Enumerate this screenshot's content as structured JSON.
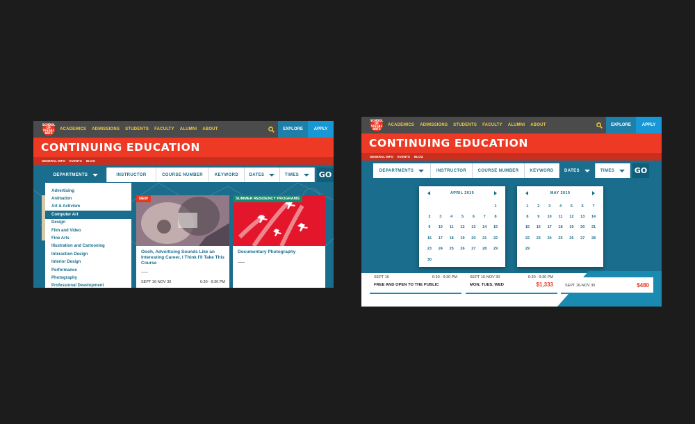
{
  "logo_text": "SCHOOL OF VISUAL ARTS",
  "nav": {
    "items": [
      "ACADEMICS",
      "ADMISSIONS",
      "STUDENTS",
      "FACULTY",
      "ALUMNI",
      "ABOUT"
    ],
    "explore": "EXPLORE",
    "apply": "APPLY"
  },
  "page_title": "CONTINUING EDUCATION",
  "subnav": [
    "GENERAL INFO",
    "EVENTS",
    "BLOG"
  ],
  "filters": {
    "departments": "DEPARTMENTS",
    "instructor": "INSTRUCTOR",
    "course_number": "COURSE NUMBER",
    "keyword": "KEYWORD",
    "dates": "DATES",
    "times": "TIMES",
    "go": "GO"
  },
  "departments_menu": {
    "selected": "Computer Art",
    "items": [
      "Advertising",
      "Animation",
      "Art & Activism",
      "Computer Art",
      "Design",
      "Film and Video",
      "Fine Arts",
      "Illustration and Cartooning",
      "Interaction Design",
      "Interior Design",
      "Performance",
      "Photography",
      "Professional Development"
    ]
  },
  "cards_a": [
    {
      "tag": "NEW",
      "title": "Oooh, Advertising Sounds Like an Interesting Career, I Think I'll Take This Course",
      "date": "SEPT 16-NOV 30",
      "time": "6:30 - 9:30 PM"
    },
    {
      "tag": "SUMMER RESIDENCY PROGRAMS",
      "title": "Documentary Photography"
    }
  ],
  "calendars": [
    {
      "month": "APRIL 2019",
      "days": [
        "",
        "",
        "",
        "",
        "",
        "",
        "1",
        "2",
        "3",
        "4",
        "5",
        "6",
        "7",
        "8",
        "9",
        "10",
        "11",
        "12",
        "13",
        "14",
        "15",
        "16",
        "17",
        "18",
        "19",
        "20",
        "21",
        "22",
        "23",
        "24",
        "25",
        "26",
        "27",
        "28",
        "29",
        "30"
      ]
    },
    {
      "month": "MAY 2019",
      "days": [
        "1",
        "2",
        "3",
        "4",
        "5",
        "6",
        "7",
        "8",
        "9",
        "10",
        "11",
        "12",
        "13",
        "14",
        "15",
        "16",
        "17",
        "18",
        "19",
        "20",
        "21",
        "22",
        "23",
        "24",
        "25",
        "26",
        "27",
        "28",
        "29"
      ]
    }
  ],
  "cards_b": [
    {
      "date": "SEPT 16",
      "time": "6:30 - 9:30 PM",
      "info": "FREE AND OPEN TO THE PUBLIC"
    },
    {
      "date": "SEPT 16-NOV 30",
      "time": "6:30 - 9:30 PM",
      "info": "MON, TUES, WED",
      "price": "$1,333"
    },
    {
      "date": "SEPT 16-NOV 30",
      "price": "$480"
    }
  ]
}
